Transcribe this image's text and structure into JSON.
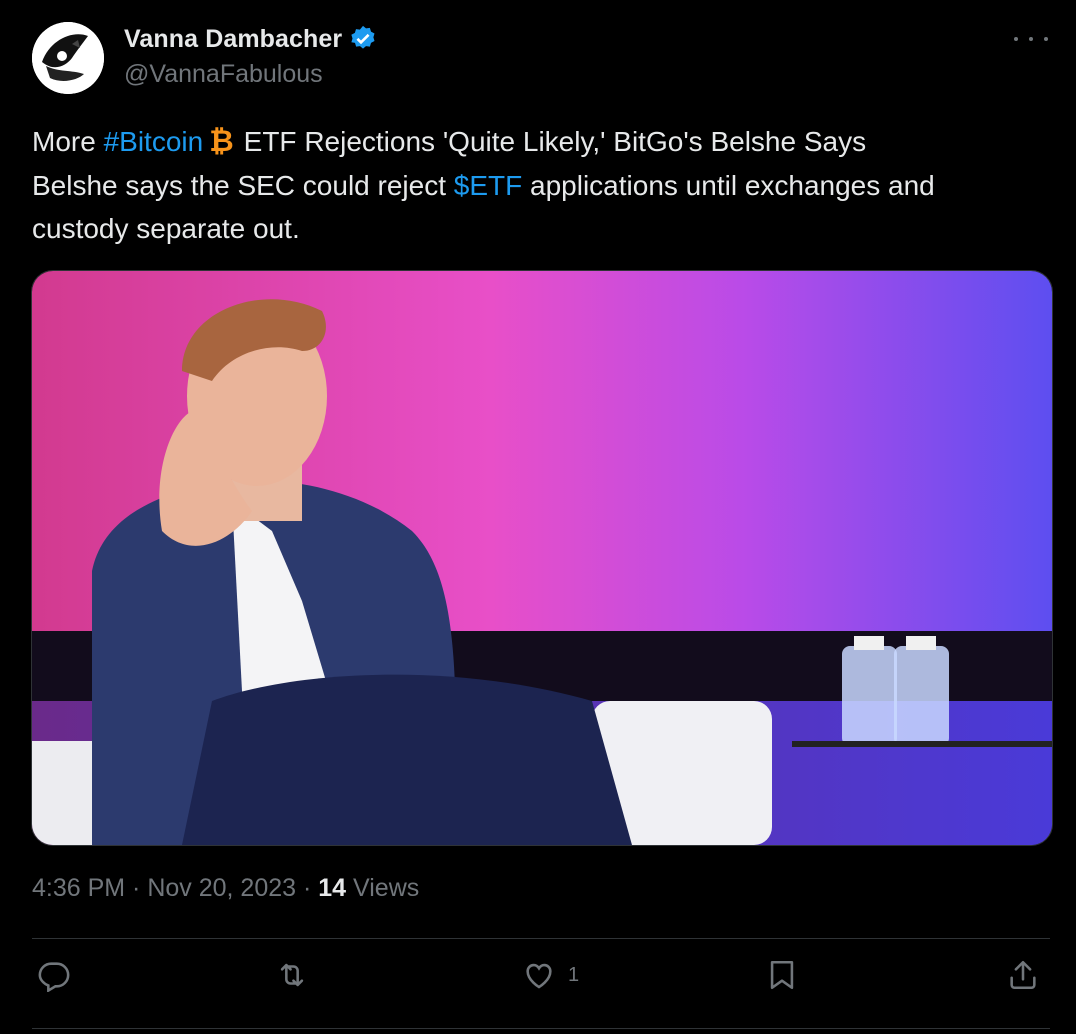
{
  "author": {
    "name": "Vanna Dambacher",
    "handle": "@VannaFabulous",
    "verified_icon": "verified-badge-icon",
    "accent": "#1d9bf0"
  },
  "tweet": {
    "line1_prefix": "More ",
    "hashtag": "#Bitcoin",
    "bitcoin_symbol": "₿",
    "line1_suffix": "ETF Rejections 'Quite Likely,' BitGo's Belshe Says",
    "line2_prefix": "Belshe says the SEC could reject ",
    "cashtag": "$ETF",
    "line2_suffix": " applications until exchanges and",
    "line3": "custody separate out."
  },
  "meta": {
    "time": "4:36 PM",
    "sep1": " · ",
    "date": "Nov 20, 2023",
    "sep2": " · ",
    "views_count": "14",
    "views_label": " Views"
  },
  "actions": {
    "reply_icon": "reply-icon",
    "retweet_icon": "retweet-icon",
    "like_icon": "heart-icon",
    "like_count": "1",
    "bookmark_icon": "bookmark-icon",
    "share_icon": "share-icon"
  },
  "colors": {
    "background": "#000000",
    "text": "#e7e9ea",
    "secondary": "#71767b",
    "link": "#1d9bf0",
    "bitcoin": "#f7931a"
  }
}
